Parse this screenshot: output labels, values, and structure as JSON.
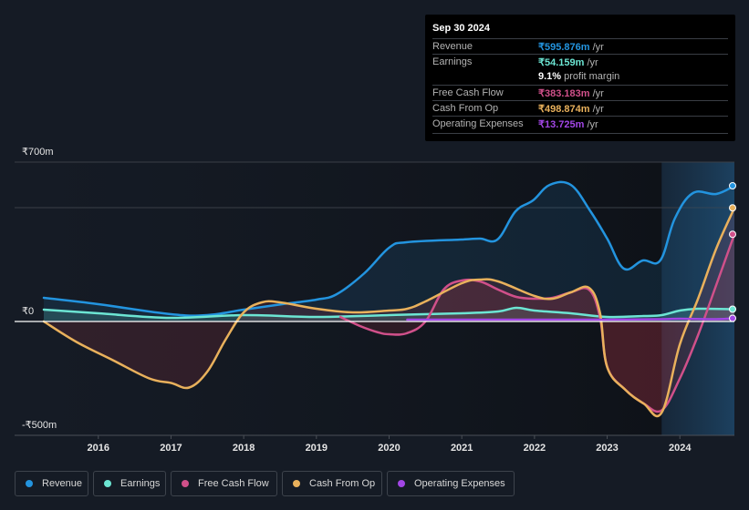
{
  "tooltip": {
    "date": "Sep 30 2024",
    "rows": [
      {
        "label": "Revenue",
        "value": "₹595.876m",
        "unit": " /yr",
        "color": "#2394df"
      },
      {
        "label": "Earnings",
        "value": "₹54.159m",
        "unit": " /yr",
        "color": "#6ce5d3"
      },
      {
        "label": "",
        "value": "9.1%",
        "unit": " profit margin",
        "color": "#ffffff"
      },
      {
        "label": "Free Cash Flow",
        "value": "₹383.183m",
        "unit": " /yr",
        "color": "#d0508a"
      },
      {
        "label": "Cash From Op",
        "value": "₹498.874m",
        "unit": " /yr",
        "color": "#e9b15c"
      },
      {
        "label": "Operating Expenses",
        "value": "₹13.725m",
        "unit": " /yr",
        "color": "#a246e6"
      }
    ]
  },
  "legend": [
    {
      "label": "Revenue",
      "color": "#2394df"
    },
    {
      "label": "Earnings",
      "color": "#6ce5d3"
    },
    {
      "label": "Free Cash Flow",
      "color": "#d0508a"
    },
    {
      "label": "Cash From Op",
      "color": "#e9b15c"
    },
    {
      "label": "Operating Expenses",
      "color": "#a246e6"
    }
  ],
  "chart_data": {
    "type": "area",
    "title": "",
    "xlabel": "",
    "ylabel": "",
    "y_tick_labels": [
      "₹700m",
      "₹0",
      "-₹500m"
    ],
    "y_ticks": [
      700,
      0,
      -500
    ],
    "ylim": [
      -500,
      700
    ],
    "xlim": [
      2015.25,
      2024.75
    ],
    "x_tick_labels": [
      "2016",
      "2017",
      "2018",
      "2019",
      "2020",
      "2021",
      "2022",
      "2023",
      "2024"
    ],
    "x_ticks": [
      2016,
      2017,
      2018,
      2019,
      2020,
      2021,
      2022,
      2023,
      2024
    ],
    "highlight_range": [
      2023.75,
      2024.75
    ],
    "grid": true,
    "series": [
      {
        "name": "Revenue",
        "color": "#2394df",
        "x": [
          2015.25,
          2016.0,
          2017.0,
          2017.5,
          2018.0,
          2018.53,
          2019.0,
          2019.28,
          2019.66,
          2020.0,
          2020.24,
          2021.0,
          2021.25,
          2021.49,
          2021.74,
          2021.98,
          2022.21,
          2022.5,
          2022.77,
          2023.0,
          2023.23,
          2023.49,
          2023.73,
          2023.93,
          2024.18,
          2024.5,
          2024.75
        ],
        "y": [
          104,
          76,
          32,
          28,
          52,
          76,
          96,
          120,
          212,
          324,
          348,
          360,
          364,
          360,
          484,
          532,
          600,
          600,
          484,
          364,
          232,
          268,
          268,
          452,
          564,
          560,
          596
        ]
      },
      {
        "name": "Earnings",
        "color": "#6ce5d3",
        "x": [
          2015.25,
          2016.0,
          2017.0,
          2018.0,
          2019.0,
          2020.0,
          2021.0,
          2021.5,
          2021.75,
          2022.0,
          2022.5,
          2023.0,
          2023.5,
          2023.75,
          2024.0,
          2024.25,
          2024.75
        ],
        "y": [
          52,
          36,
          16,
          28,
          20,
          28,
          36,
          44,
          60,
          48,
          36,
          20,
          24,
          28,
          48,
          56,
          54
        ]
      },
      {
        "name": "Free Cash Flow",
        "color": "#d0508a",
        "x": [
          2019.33,
          2019.6,
          2019.85,
          2020.0,
          2020.24,
          2020.5,
          2020.75,
          2021.0,
          2021.25,
          2021.5,
          2021.75,
          2022.0,
          2022.25,
          2022.5,
          2022.75,
          2022.9,
          2023.0,
          2023.25,
          2023.5,
          2023.75,
          2024.0,
          2024.25,
          2024.5,
          2024.75
        ],
        "y": [
          20,
          -20,
          -48,
          -56,
          -52,
          0,
          140,
          180,
          176,
          140,
          108,
          100,
          104,
          128,
          140,
          20,
          -200,
          -300,
          -360,
          -390,
          -250,
          -60,
          160,
          383
        ]
      },
      {
        "name": "Cash From Op",
        "color": "#e9b15c",
        "x": [
          2015.25,
          2015.7,
          2016.2,
          2016.7,
          2017.0,
          2017.25,
          2017.5,
          2017.75,
          2018.0,
          2018.25,
          2018.5,
          2019.0,
          2019.5,
          2020.0,
          2020.25,
          2020.5,
          2021.0,
          2021.25,
          2021.5,
          2022.0,
          2022.25,
          2022.5,
          2022.75,
          2022.9,
          2023.0,
          2023.25,
          2023.5,
          2023.75,
          2024.0,
          2024.25,
          2024.5,
          2024.75
        ],
        "y": [
          0,
          -90,
          -170,
          -250,
          -270,
          -290,
          -220,
          -80,
          40,
          84,
          84,
          56,
          40,
          48,
          56,
          88,
          168,
          184,
          176,
          112,
          100,
          128,
          148,
          40,
          -200,
          -300,
          -360,
          -400,
          -100,
          100,
          320,
          499
        ]
      },
      {
        "name": "Operating Expenses",
        "color": "#a246e6",
        "x": [
          2020.25,
          2021.0,
          2022.0,
          2023.0,
          2023.75,
          2024.0,
          2024.5,
          2024.75
        ],
        "y": [
          8,
          8,
          8,
          8,
          10,
          12,
          10,
          14
        ]
      }
    ]
  }
}
